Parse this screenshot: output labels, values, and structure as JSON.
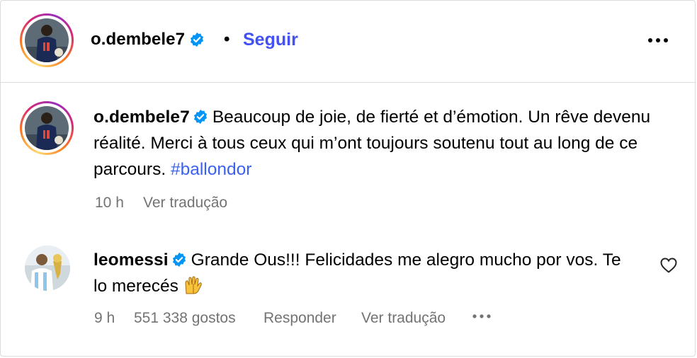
{
  "header": {
    "username": "o.dembele7",
    "separator": "•",
    "follow_label": "Seguir",
    "more_icon": "more-horizontal-icon"
  },
  "caption": {
    "username": "o.dembele7",
    "text": "Beaucoup de joie, de fierté et d’émotion. Un rêve devenu réalité. Merci à tous ceux qui m’ont toujours soutenu tout au long de ce parcours. ",
    "hashtag": "#ballondor",
    "time": "10 h",
    "translate_label": "Ver tradução"
  },
  "comment": {
    "username": "leomessi",
    "text": "Grande Ous!!! Felicidades me alegro mucho por vos. Te lo merecés ",
    "emoji": "raising-hands-emoji",
    "time": "9 h",
    "likes": "551 338 gostos",
    "reply_label": "Responder",
    "translate_label": "Ver tradução",
    "like_icon": "heart-outline-icon"
  },
  "colors": {
    "link_blue": "#4150f7",
    "hashtag_blue": "#3b62ee",
    "verified_blue": "#0095f6",
    "secondary_text": "#737373",
    "divider": "#dbdbdb"
  }
}
